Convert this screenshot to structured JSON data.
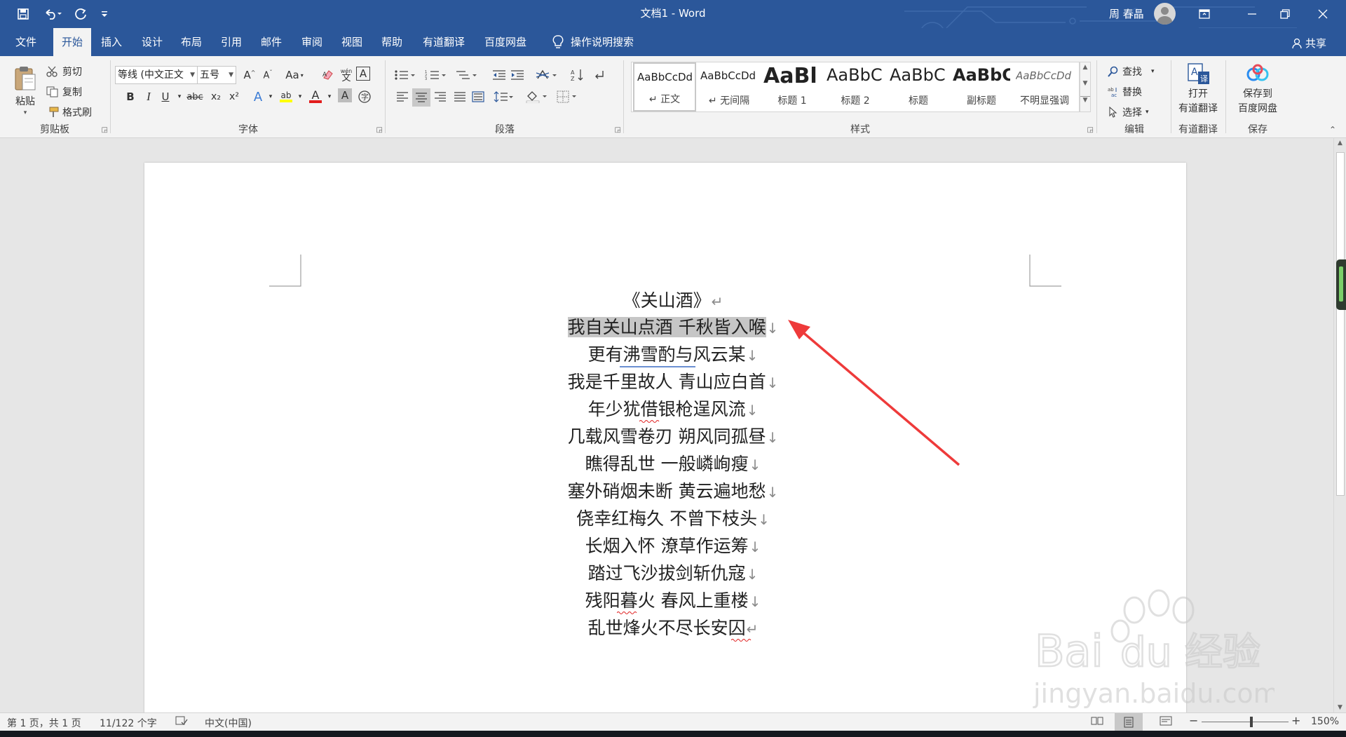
{
  "titlebar": {
    "title": "文档1 - Word",
    "user": "周 春晶",
    "quick_access": {
      "save_icon": "save-icon",
      "undo_icon": "undo-icon",
      "redo_icon": "redo-icon",
      "customize_icon": "customize-icon"
    }
  },
  "menu": {
    "tabs": [
      "文件",
      "开始",
      "插入",
      "设计",
      "布局",
      "引用",
      "邮件",
      "审阅",
      "视图",
      "帮助",
      "有道翻译",
      "百度网盘"
    ],
    "active": "开始",
    "tell_me": "操作说明搜索",
    "share": "共享"
  },
  "ribbon": {
    "clipboard": {
      "label": "剪贴板",
      "paste": "粘贴",
      "cut": "剪切",
      "copy": "复制",
      "format_painter": "格式刷"
    },
    "font": {
      "label": "字体",
      "font_name": "等线 (中文正文",
      "font_size": "五号",
      "change_case": "Aa",
      "wen": "wén",
      "bold": "B",
      "italic": "I",
      "underline": "U",
      "strike": "abc",
      "subscript": "x₂",
      "superscript": "x²",
      "text_effect": "A",
      "highlight": "ab",
      "font_color": "A",
      "char_shading": "A"
    },
    "paragraph": {
      "label": "段落"
    },
    "styles": {
      "label": "样式",
      "items": [
        {
          "sample": "AaBbCcDd",
          "name": "正文"
        },
        {
          "sample": "AaBbCcDd",
          "name": "无间隔"
        },
        {
          "sample": "AaBl",
          "name": "标题 1"
        },
        {
          "sample": "AaBbC",
          "name": "标题 2"
        },
        {
          "sample": "AaBbC",
          "name": "标题"
        },
        {
          "sample": "AaBbC",
          "name": "副标题"
        },
        {
          "sample": "AaBbCcDd",
          "name": "不明显强调"
        }
      ]
    },
    "editing": {
      "label": "编辑",
      "find": "查找",
      "replace": "替换",
      "select": "选择"
    },
    "youdao": {
      "label": "有道翻译",
      "button_line1": "打开",
      "button_line2": "有道翻译"
    },
    "save": {
      "label": "保存",
      "button_line1": "保存到",
      "button_line2": "百度网盘"
    }
  },
  "document": {
    "lines": [
      {
        "text": "《关山酒》",
        "mark": "↵"
      },
      {
        "text": "我自关山点酒  千秋皆入喉",
        "mark": "↓",
        "selected": true
      },
      {
        "text": "更有沸雪酌与风云某",
        "mark": "↓"
      },
      {
        "text": "我是千里故人  青山应白首",
        "mark": "↓"
      },
      {
        "text": "年少犹借银枪逞风流",
        "mark": "↓"
      },
      {
        "text": "几载风雪卷刃  朔风同孤昼",
        "mark": "↓"
      },
      {
        "text": "瞧得乱世  一般嶙峋瘦",
        "mark": "↓"
      },
      {
        "text": "塞外硝烟未断  黄云遍地愁",
        "mark": "↓"
      },
      {
        "text": "侥幸红梅久  不曾下枝头",
        "mark": "↓"
      },
      {
        "text": "长烟入怀  潦草作运筹",
        "mark": "↓"
      },
      {
        "text": "踏过飞沙拔剑斩仇寇",
        "mark": "↓"
      },
      {
        "text": "残阳暮火  春风上重楼",
        "mark": "↓"
      },
      {
        "text": "乱世烽火不尽长安囚",
        "mark": "↵"
      }
    ]
  },
  "statusbar": {
    "page": "第 1 页，共 1 页",
    "words": "11/122 个字",
    "language": "中文(中国)",
    "zoom": "150%"
  },
  "colors": {
    "accent": "#2b579a",
    "ribbon_bg": "#f3f3f3",
    "annotation_arrow": "#ee3a3a"
  },
  "watermark": {
    "brand": "Bai",
    "brand2": "du",
    "cn": "经验",
    "url": "jingyan.baidu.com"
  }
}
